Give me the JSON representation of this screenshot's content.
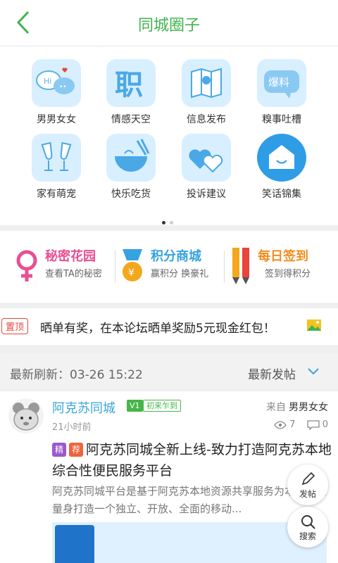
{
  "header": {
    "title": "同城圈子",
    "back_icon": "chevron-left-icon"
  },
  "grid": [
    {
      "label": "男男女女",
      "icon": "chat-bubbles-icon"
    },
    {
      "label": "情感天空",
      "icon": "job-icon"
    },
    {
      "label": "信息发布",
      "icon": "map-icon"
    },
    {
      "label": "糗事吐槽",
      "icon": "baoliao-icon"
    },
    {
      "label": "家有萌宠",
      "icon": "champagne-icon"
    },
    {
      "label": "快乐吃货",
      "icon": "bowl-icon"
    },
    {
      "label": "投诉建议",
      "icon": "hearts-icon"
    },
    {
      "label": "笑话锦集",
      "icon": "house-smile-icon"
    }
  ],
  "pager": {
    "pages": 2,
    "active": 0
  },
  "banners": [
    {
      "title": "秘密花园",
      "subtitle": "查看TA的秘密",
      "icon": "female-symbol-icon",
      "color": "#e94f92"
    },
    {
      "title": "积分商城",
      "subtitle": "赢积分 换豪礼",
      "icon": "medal-icon",
      "color": "#35a3e0"
    },
    {
      "title": "每日签到",
      "subtitle": "签到得积分",
      "icon": "pencils-icon",
      "color": "#f08d1e"
    }
  ],
  "pinned": {
    "badge": "置顶",
    "text": "晒单有奖，在本论坛晒单奖励5元现金红包！",
    "icon": "image-icon"
  },
  "feed_bar": {
    "refresh_label": "最新刷新：",
    "refresh_time": "03-26 15:22",
    "sort_label": "最新发帖"
  },
  "post": {
    "author": "阿克苏同城",
    "level": "V1",
    "level_title": "初来乍到",
    "from_label": "来自",
    "from_board": "男男女女",
    "time": "21小时前",
    "views": "7",
    "comments": "0",
    "tags": [
      {
        "text": "精",
        "color": "#9b59d0"
      },
      {
        "text": "荐",
        "color": "#f0633c"
      }
    ],
    "title": "阿克苏同城全新上线-致力打造阿克苏本地综合性便民服务平台",
    "excerpt": "阿克苏同城平台是基于阿克苏本地资源共享服务为本地居民量身打造一个独立、开放、全面的移动..."
  },
  "fab": {
    "post_label": "发帖",
    "search_label": "搜索"
  },
  "colors": {
    "accent": "#3fb34f",
    "link": "#3aa5d8"
  }
}
